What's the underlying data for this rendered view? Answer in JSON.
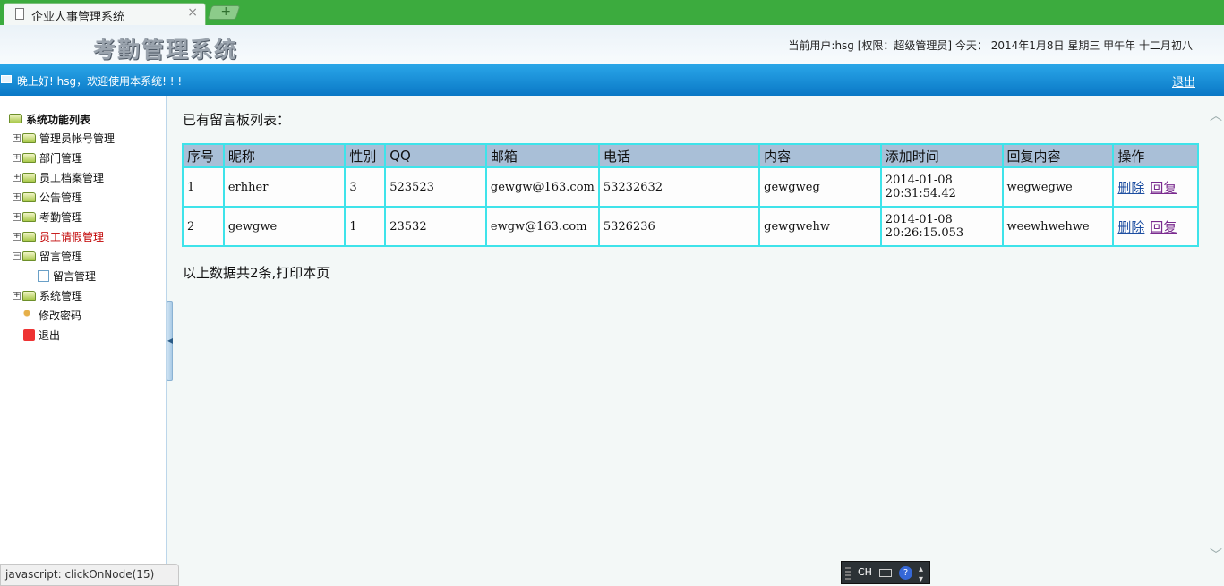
{
  "browser": {
    "tab_title": "企业人事管理系统",
    "tab_close": "×",
    "new_tab": "+"
  },
  "header": {
    "logo_text": "考勤管理系统",
    "user_info": "当前用户:hsg [权限：超级管理员] 今天： 2014年1月8日 星期三 甲午年 十二月初八"
  },
  "welcome": {
    "message": "晚上好! hsg，欢迎使用本系统! ! !",
    "logout_label": "退出"
  },
  "sidebar": {
    "root_label": "系统功能列表",
    "items": [
      {
        "label": "管理员帐号管理",
        "expander": "+"
      },
      {
        "label": "部门管理",
        "expander": "+"
      },
      {
        "label": "员工档案管理",
        "expander": "+"
      },
      {
        "label": "公告管理",
        "expander": "+"
      },
      {
        "label": "考勤管理",
        "expander": "+"
      },
      {
        "label": "员工请假管理",
        "expander": "+"
      },
      {
        "label": "留言管理",
        "expander": "−"
      },
      {
        "label": "留言管理"
      },
      {
        "label": "系统管理",
        "expander": "+"
      },
      {
        "label": "修改密码"
      },
      {
        "label": "退出"
      }
    ]
  },
  "main": {
    "heading": "已有留言板列表：",
    "columns": [
      "序号",
      "昵称",
      "性别",
      "QQ",
      "邮箱",
      "电话",
      "内容",
      "添加时间",
      "回复内容",
      "操作"
    ],
    "rows": [
      {
        "id": "1",
        "nickname": "erhher",
        "gender": "3",
        "qq": "523523",
        "email": "gewgw@163.com",
        "phone": "53232632",
        "content": "gewgweg",
        "time_date": "2014-01-08",
        "time_clock": "20:31:54.42",
        "reply": "wegwegwe"
      },
      {
        "id": "2",
        "nickname": "gewgwe",
        "gender": "1",
        "qq": "23532",
        "email": "ewgw@163.com",
        "phone": "5326236",
        "content": "gewgwehw",
        "time_date": "2014-01-08",
        "time_clock": "20:26:15.053",
        "reply": "weewhwehwe"
      }
    ],
    "op_delete": "删除",
    "op_reply": "回复",
    "footer_note": "以上数据共2条,打印本页"
  },
  "statusbar": {
    "text": "javascript: clickOnNode(15)"
  },
  "ime": {
    "lang": "CH",
    "help": "?"
  }
}
